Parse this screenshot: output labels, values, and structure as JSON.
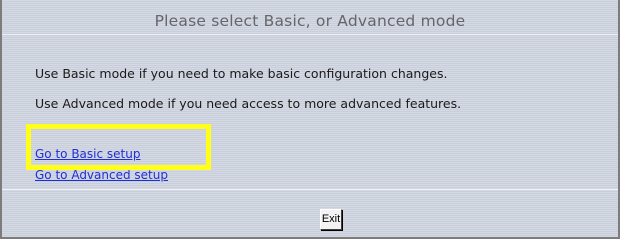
{
  "page": {
    "title": "Please select Basic, or Advanced mode",
    "basic_text": "Use Basic mode if you need to make basic configuration changes.",
    "advanced_text": "Use Advanced mode if you need access to more advanced features."
  },
  "links": {
    "basic_setup": "Go to Basic setup",
    "advanced_setup": "Go to Advanced setup"
  },
  "buttons": {
    "exit": "Exit"
  },
  "colors": {
    "highlight": "#ffff19",
    "link": "#1f2fd6",
    "background": "#cfd3df"
  }
}
